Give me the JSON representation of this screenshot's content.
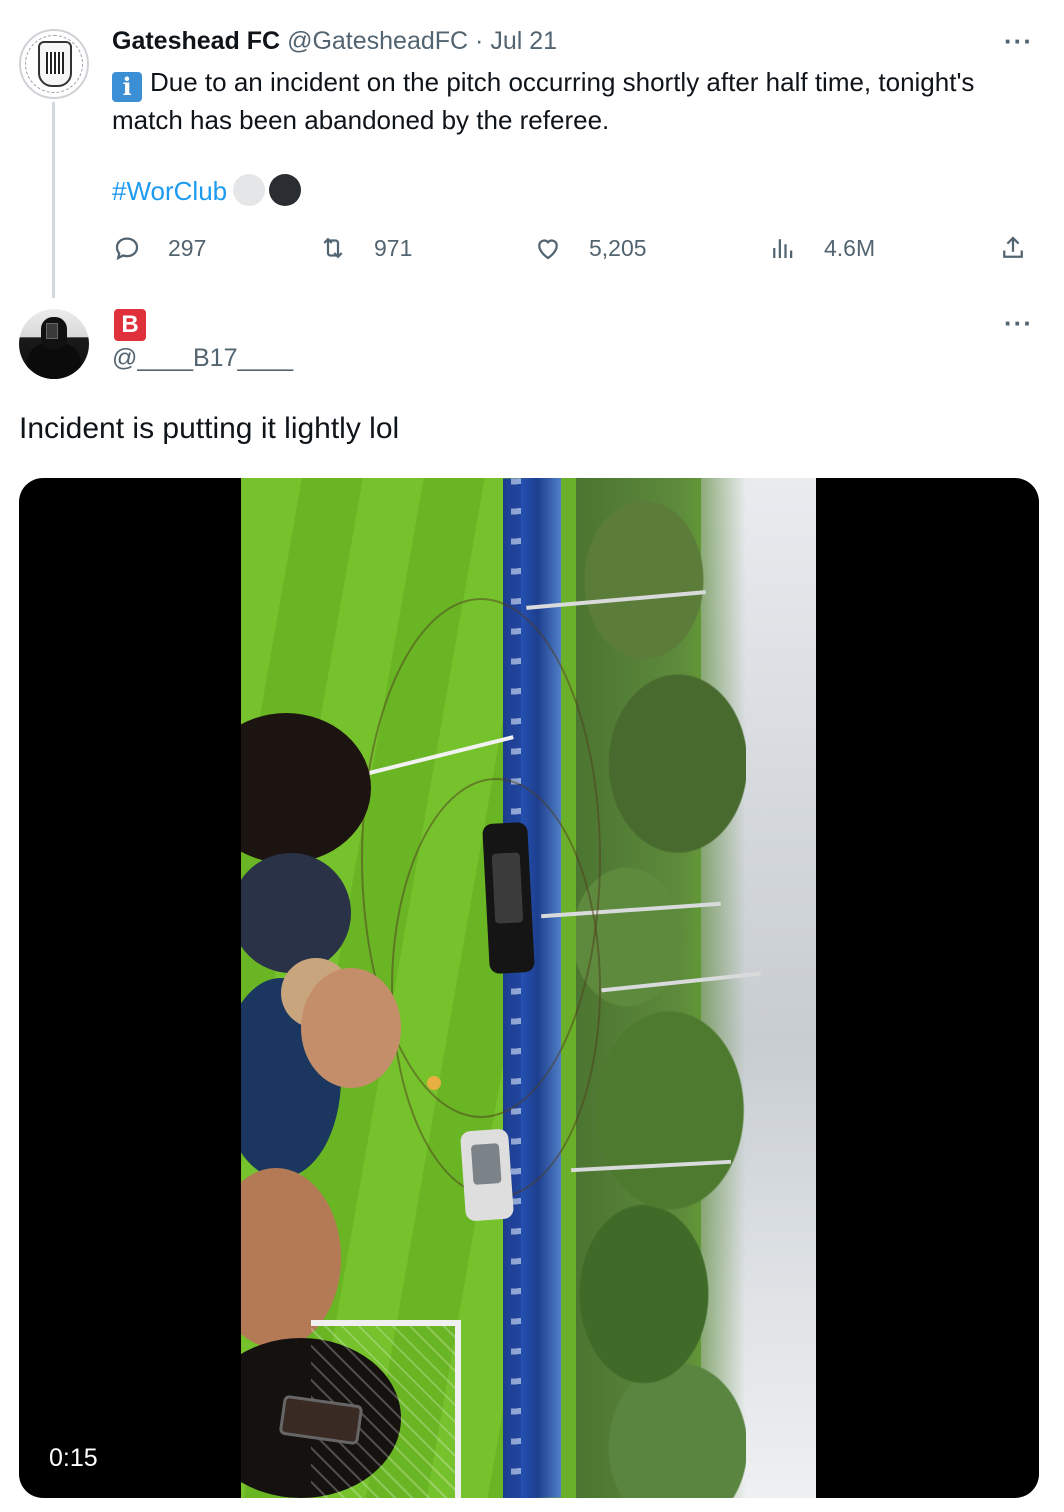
{
  "tweet": {
    "display_name": "Gateshead FC",
    "handle": "@GatesheadFC",
    "separator": "·",
    "date": "Jul 21",
    "info_icon_glyph": "i",
    "text": "Due to an incident on the pitch occurring shortly after half time, tonight's match has been abandoned by the referee.",
    "hashtag": "#WorClub",
    "more_label": "···",
    "stats": {
      "replies": "297",
      "retweets": "971",
      "likes": "5,205",
      "views": "4.6M"
    }
  },
  "reply": {
    "badge_letter": "B",
    "handle": "@____B17____",
    "text": "Incident is putting it lightly lol",
    "more_label": "···",
    "media": {
      "duration": "0:15"
    }
  },
  "colors": {
    "link": "#1d9bf0",
    "secondary_text": "#536471",
    "badge_red": "#e0303c",
    "info_blue": "#3b8fd4"
  },
  "icons": [
    "reply-icon",
    "retweet-icon",
    "like-icon",
    "views-icon",
    "share-icon",
    "info-icon",
    "more-icon"
  ]
}
